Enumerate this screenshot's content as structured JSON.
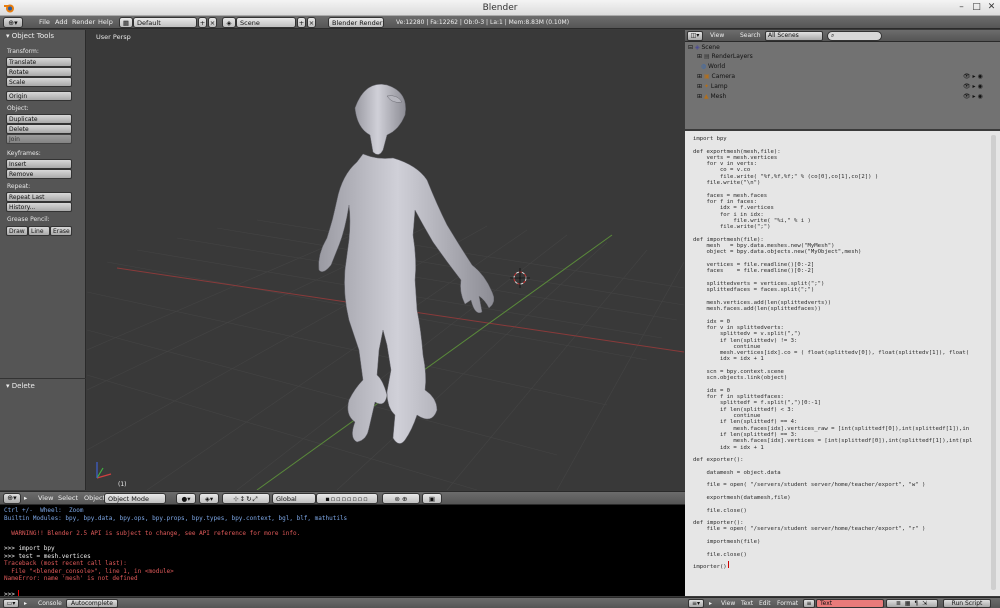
{
  "window": {
    "title": "Blender"
  },
  "info_header": {
    "menus": [
      "File",
      "Add",
      "Render",
      "Help"
    ],
    "screen": "Default",
    "scene": "Scene",
    "engine": "Blender Render",
    "stats": "Ve:12280 | Fa:12262 | Ob:0-3 | La:1 | Mem:8.83M (0.10M)"
  },
  "tool_shelf": {
    "title": "Object Tools",
    "transform": {
      "label": "Transform:",
      "buttons": [
        "Translate",
        "Rotate",
        "Scale"
      ]
    },
    "origin": "Origin",
    "object": {
      "label": "Object:",
      "buttons": [
        "Duplicate",
        "Delete",
        "Join"
      ]
    },
    "keyframes": {
      "label": "Keyframes:",
      "buttons": [
        "Insert",
        "Remove"
      ]
    },
    "repeat": {
      "label": "Repeat:",
      "buttons": [
        "Repeat Last",
        "History..."
      ]
    },
    "grease_pencil": {
      "label": "Grease Pencil:",
      "buttons": [
        "Draw",
        "Line",
        "Erase"
      ]
    },
    "operator_title": "Delete"
  },
  "viewport": {
    "label": "User Persp",
    "object_label": "(1)"
  },
  "outliner": {
    "menus": [
      "View",
      "Search"
    ],
    "display_mode": "All Scenes",
    "items": [
      "Scene",
      "RenderLayers",
      "World",
      "Camera",
      "Lamp",
      "Mesh"
    ]
  },
  "text_editor": {
    "code": "import bpy\n\ndef exportmesh(mesh,file):\n    verts = mesh.vertices\n    for v in verts:\n        co = v.co\n        file.write( \"%f,%f,%f;\" % (co[0],co[1],co[2]) )\n    file.write(\"\\n\")\n\n    faces = mesh.faces\n    for f in faces:\n        idx = f.vertices\n        for i in idx:\n            file.write( \"%i,\" % i )\n        file.write(\";\")\n\ndef importmesh(file):\n    mesh   = bpy.data.meshes.new(\"MyMesh\")\n    object = bpy.data.objects.new(\"MyObject\",mesh)\n\n    vertices = file.readline()[0:-2]\n    faces    = file.readline()[0:-2]\n\n    splittedverts = vertices.split(\";\")\n    splittedfaces = faces.split(\";\")\n\n    mesh.vertices.add(len(splittedverts))\n    mesh.faces.add(len(splittedfaces))\n\n    idx = 0\n    for v in splittedverts:\n        splittedv = v.split(\",\")\n        if len(splittedv) != 3:\n            continue\n        mesh.vertices[idx].co = ( float(splittedv[0]), float(splittedv[1]), float(\n        idx = idx + 1\n\n    scn = bpy.context.scene\n    scn.objects.link(object)\n\n    idx = 0\n    for f in splittedfaces:\n        splittedf = f.split(\",\")[0:-1]\n        if len(splittedf) < 3:\n            continue\n        if len(splittedf) == 4:\n            mesh.faces[idx].vertices_raw = [int(splittedf[0]),int(splittedf[1]),in\n        if len(splittedf) == 3:\n            mesh.faces[idx].vertices = [int(splittedf[0]),int(splittedf[1]),int(spl\n        idx = idx + 1\n\ndef exporter():\n\n    datamesh = object.data\n\n    file = open( \"/servers/student server/home/teacher/export\", \"w\" )\n\n    exportmesh(datamesh,file)\n\n    file.close()\n\ndef importer():\n    file = open( \"/servers/student server/home/teacher/export\", \"r\" )\n\n    importmesh(file)\n\n    file.close()\n\nimporter()",
    "footer": {
      "menus": [
        "View",
        "Text",
        "Edit",
        "Format"
      ],
      "name": "Text",
      "run": "Run Script"
    }
  },
  "view3d_header": {
    "menus": [
      "View",
      "Select",
      "Object"
    ],
    "mode": "Object Mode",
    "pivot": "Global"
  },
  "console": {
    "lines": [
      {
        "t": "Ctrl +/-  Wheel:  Zoom",
        "c": "#7da7e6"
      },
      {
        "t": "Builtin Modules: bpy, bpy.data, bpy.ops, bpy.props, bpy.types, bpy.context, bgl, blf, mathutils",
        "c": "#7da7e6"
      },
      {
        "t": "",
        "c": "#fff"
      },
      {
        "t": "  WARNING!! Blender 2.5 API is subject to change, see API reference for more info.",
        "c": "#e05a5a"
      },
      {
        "t": "",
        "c": "#fff"
      },
      {
        "t": ">>> import bpy",
        "c": "#eeeeee"
      },
      {
        "t": ">>> test = mesh.vertices",
        "c": "#eeeeee"
      },
      {
        "t": "Traceback (most recent call last):",
        "c": "#e05a5a"
      },
      {
        "t": "  File \"<blender_console>\", line 1, in <module>",
        "c": "#e05a5a"
      },
      {
        "t": "NameError: name 'mesh' is not defined",
        "c": "#e05a5a"
      },
      {
        "t": "",
        "c": "#fff"
      }
    ],
    "prompt": ">>> ",
    "footer": {
      "menus": [
        "Console"
      ],
      "autocomplete": "Autocomplete"
    }
  }
}
